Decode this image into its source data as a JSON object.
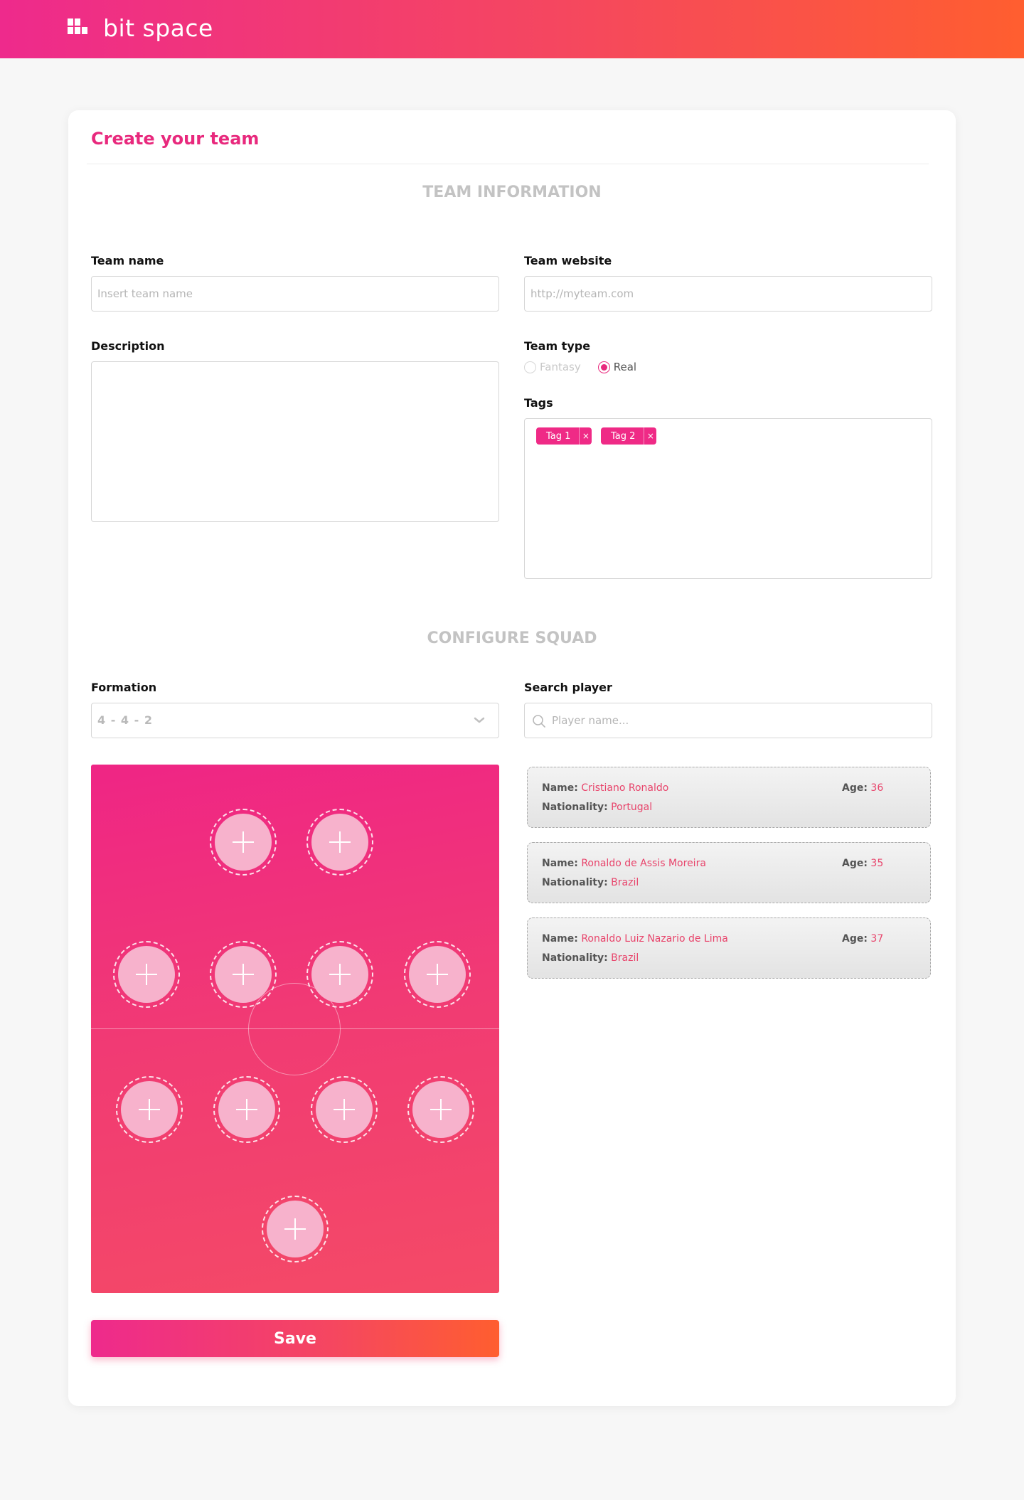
{
  "app": {
    "brand": "bit space"
  },
  "page": {
    "title": "Create your team"
  },
  "sections": {
    "team_info": "TEAM INFORMATION",
    "squad": "CONFIGURE SQUAD"
  },
  "team_name": {
    "label": "Team name",
    "placeholder": "Insert team name",
    "value": ""
  },
  "team_website": {
    "label": "Team website",
    "placeholder": "http://myteam.com",
    "value": ""
  },
  "description": {
    "label": "Description",
    "value": ""
  },
  "team_type": {
    "label": "Team type",
    "options": [
      {
        "label": "Fantasy",
        "checked": false
      },
      {
        "label": "Real",
        "checked": true
      }
    ]
  },
  "tags": {
    "label": "Tags",
    "items": [
      "Tag 1",
      "Tag 2"
    ],
    "remove_glyph": "×"
  },
  "formation": {
    "label": "Formation",
    "value": "4 - 4 - 2"
  },
  "search_player": {
    "label": "Search player",
    "placeholder": "Player name..."
  },
  "players": [
    {
      "name_label": "Name:",
      "name": "Cristiano Ronaldo",
      "age_label": "Age:",
      "age": "36",
      "nationality_label": "Nationality:",
      "nationality": "Portugal"
    },
    {
      "name_label": "Name:",
      "name": "Ronaldo de Assis Moreira",
      "age_label": "Age:",
      "age": "35",
      "nationality_label": "Nationality:",
      "nationality": "Brazil"
    },
    {
      "name_label": "Name:",
      "name": "Ronaldo Luiz Nazario de Lima",
      "age_label": "Age:",
      "age": "37",
      "nationality_label": "Nationality:",
      "nationality": "Brazil"
    }
  ],
  "pitch": {
    "slot_count": 11,
    "slot_icon": "plus-icon"
  },
  "actions": {
    "save_label": "Save"
  },
  "colors": {
    "accent": "#e8297d",
    "gradient_start": "#ee2a8c",
    "gradient_end": "#ff5e2f",
    "value_text": "#e8446b"
  }
}
